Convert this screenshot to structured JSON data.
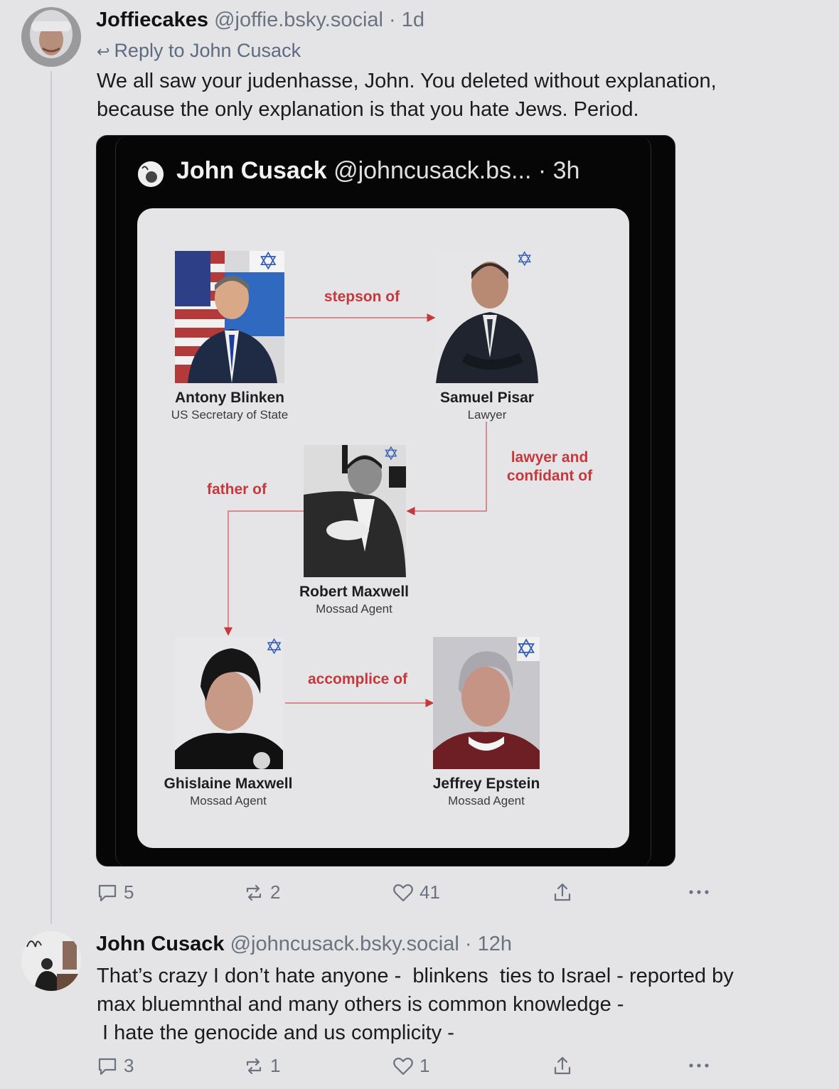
{
  "post1": {
    "author_name": "Joffiecakes",
    "author_handle": "@joffie.bsky.social",
    "time": "· 1d",
    "reply_label": "Reply to John Cusack",
    "text_line1": "We all saw your judenhasse, John. You deleted without explanation,",
    "text_line2": "because the only explanation is that you hate Jews. Period.",
    "counts": {
      "replies": "5",
      "reposts": "2",
      "likes": "41"
    }
  },
  "embed": {
    "name": "John Cusack",
    "handle": "@johncusack.bs...",
    "time": "· 3h",
    "people": [
      {
        "name": "Antony Blinken",
        "role": "US Secretary of State"
      },
      {
        "name": "Samuel Pisar",
        "role": "Lawyer"
      },
      {
        "name": "Robert Maxwell",
        "role": "Mossad Agent"
      },
      {
        "name": "Ghislaine Maxwell",
        "role": "Mossad Agent"
      },
      {
        "name": "Jeffrey Epstein",
        "role": "Mossad Agent"
      }
    ],
    "relations": {
      "stepson": "stepson of",
      "lawyer1": "lawyer and",
      "lawyer2": "confidant of",
      "father": "father of",
      "accomplice": "accomplice of"
    },
    "star_glyph": "✡"
  },
  "post2": {
    "author_name": "John Cusack",
    "author_handle": "@johncusack.bsky.social",
    "time": "· 12h",
    "text_line1": "That’s crazy I don’t hate anyone -  blinkens  ties to Israel - reported by",
    "text_line2": "max bluemnthal and many others is common knowledge -",
    "text_line3": " I hate the genocide and us complicity -",
    "counts": {
      "replies": "3",
      "reposts": "1",
      "likes": "1"
    }
  },
  "icons": {
    "reply": "reply-arrow-icon",
    "comment": "comment-bubble-icon",
    "repost": "repost-icon",
    "like": "heart-icon",
    "share": "share-icon",
    "more": "more-dots-icon"
  }
}
